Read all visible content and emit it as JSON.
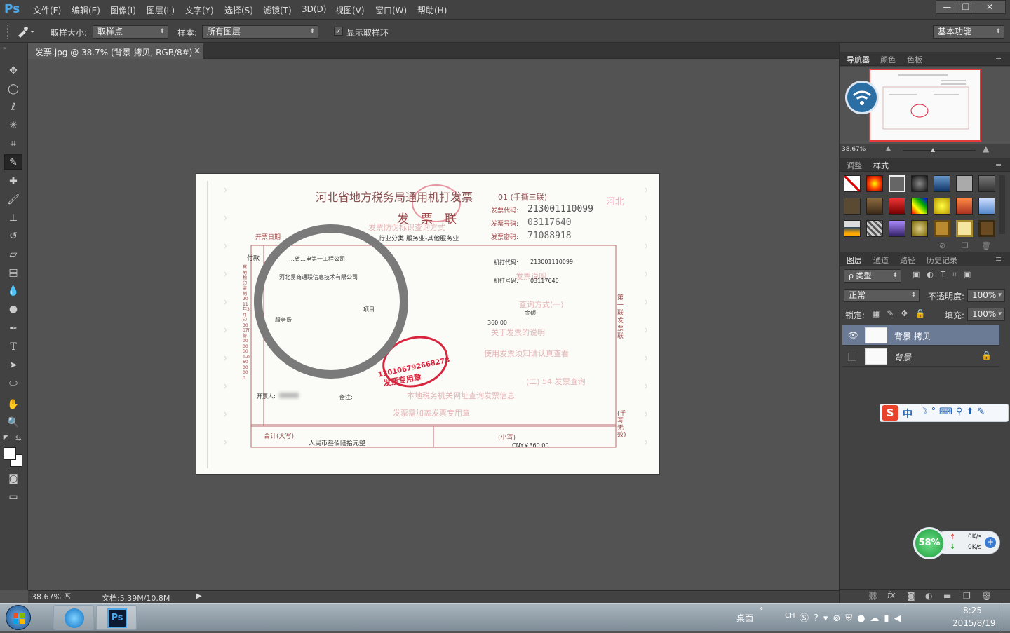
{
  "app": {
    "logo": "Ps"
  },
  "menu": [
    "文件(F)",
    "编辑(E)",
    "图像(I)",
    "图层(L)",
    "文字(Y)",
    "选择(S)",
    "滤镜(T)",
    "3D(D)",
    "视图(V)",
    "窗口(W)",
    "帮助(H)"
  ],
  "window_controls": {
    "minimize": "—",
    "restore": "❐",
    "close": "✕"
  },
  "options": {
    "sample_size_label": "取样大小:",
    "sample_size_value": "取样点",
    "sample_label": "样本:",
    "sample_value": "所有图层",
    "show_ring_label": "显示取样环",
    "show_ring_checked": true,
    "workspace": "基本功能"
  },
  "document_tab": {
    "title": "发票.jpg @ 38.7% (背景 拷贝, RGB/8#) *",
    "close": "×"
  },
  "status": {
    "zoom": "38.67%",
    "doc_size": "文档:5.39M/10.8M"
  },
  "invoice": {
    "title": "河北省地方税务局通用机打发票",
    "title_suffix": "01 (手撕三联)",
    "copy_name": "发　票　联",
    "code_label": "发票代码:",
    "code_value": "213001110099",
    "number_label": "发票号码:",
    "number_value": "03117640",
    "password_label": "发票密码:",
    "password_value": "71088918",
    "date_label": "开票日期",
    "industry": "行业分类:服务业-其他服务业",
    "payer": "付款",
    "payer_name": "…省…电第一工程公司",
    "payee_name": "河北易商通联信息技术有限公司",
    "machine_code_label": "机打代码:",
    "machine_code": "213001110099",
    "machine_no_label": "机打号码:",
    "machine_no": "03117640",
    "item_label": "项目",
    "amount_label": "金额",
    "item_name": "服务费",
    "amount": "360.00",
    "issuer_label": "开票人:",
    "remark_label": "备注:",
    "total_label": "合计(大写)",
    "total_text": "人民币叁佰陆拾元整",
    "small_label": "(小写)",
    "small_value": "CNY￥360.00",
    "side_note": "第一联 发票联",
    "invalid_note": "(手写无效)",
    "stamp_number": "130106792668278",
    "stamp_text": "发票专用章",
    "left_vertical": "冀地税印 监制 2011年3月印 300万份 0000001-06000000"
  },
  "navigator": {
    "tabs": [
      "导航器",
      "颜色",
      "色板"
    ],
    "zoom": "38.67%"
  },
  "styles_panel": {
    "tabs": [
      "调整",
      "样式"
    ]
  },
  "layers_panel": {
    "tabs": [
      "图层",
      "通道",
      "路径",
      "历史记录"
    ],
    "filter": "ρ 类型",
    "blend_mode": "正常",
    "opacity_label": "不透明度:",
    "opacity": "100%",
    "lock_label": "锁定:",
    "fill_label": "填充:",
    "fill": "100%",
    "layers": [
      {
        "name": "背景 拷贝",
        "visible": true,
        "selected": true
      },
      {
        "name": "背景",
        "visible": false,
        "selected": false,
        "locked": true
      }
    ]
  },
  "ime_bar": {
    "mode": "中"
  },
  "net_widget": {
    "percent": "58%",
    "up": "0K/s",
    "down": "0K/s"
  },
  "taskbar": {
    "desktop": "桌面",
    "lang": "CH",
    "time": "8:25",
    "date": "2015/8/19",
    "ps": "Ps"
  },
  "colors": {
    "accent": "#4ea8e8",
    "chrome": "#424242",
    "canvas": "#535353",
    "stamp_red": "#d8243c"
  }
}
